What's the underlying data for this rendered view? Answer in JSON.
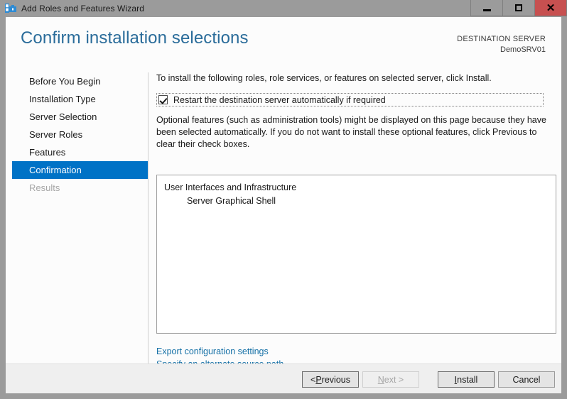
{
  "window": {
    "title": "Add Roles and Features Wizard",
    "icon": "server-wizard-icon",
    "minimize_label": "—",
    "maximize_label": "□",
    "close_label": "✕"
  },
  "header": {
    "page_title": "Confirm installation selections",
    "destination_label": "DESTINATION SERVER",
    "destination_server": "DemoSRV01"
  },
  "sidebar": {
    "items": [
      {
        "label": "Before You Begin",
        "state": "normal"
      },
      {
        "label": "Installation Type",
        "state": "normal"
      },
      {
        "label": "Server Selection",
        "state": "normal"
      },
      {
        "label": "Server Roles",
        "state": "normal"
      },
      {
        "label": "Features",
        "state": "normal"
      },
      {
        "label": "Confirmation",
        "state": "selected"
      },
      {
        "label": "Results",
        "state": "disabled"
      }
    ]
  },
  "main": {
    "intro": "To install the following roles, role services, or features on selected server, click Install.",
    "restart_checkbox_label": "Restart the destination server automatically if required",
    "restart_checkbox_checked": true,
    "optional_note": "Optional features (such as administration tools) might be displayed on this page because they have been selected automatically. If you do not want to install these optional features, click Previous to clear their check boxes.",
    "selections": [
      {
        "label": "User Interfaces and Infrastructure",
        "level": 0
      },
      {
        "label": "Server Graphical Shell",
        "level": 1
      }
    ],
    "links": [
      {
        "label": "Export configuration settings"
      },
      {
        "label": "Specify an alternate source path"
      }
    ]
  },
  "footer": {
    "previous": {
      "prefix": "< ",
      "mnemonic": "P",
      "rest": "revious",
      "enabled": true
    },
    "next": {
      "prefix": "",
      "mnemonic": "N",
      "rest": "ext >",
      "enabled": false
    },
    "install": {
      "prefix": "",
      "mnemonic": "I",
      "rest": "nstall",
      "enabled": true
    },
    "cancel": {
      "prefix": "",
      "mnemonic": "",
      "rest": "Cancel",
      "enabled": true
    }
  },
  "colors": {
    "accent": "#0072c6",
    "title_link": "#2a6c9a",
    "link": "#1570a6",
    "frame": "#9b9b9b",
    "close_button": "#c75050"
  }
}
